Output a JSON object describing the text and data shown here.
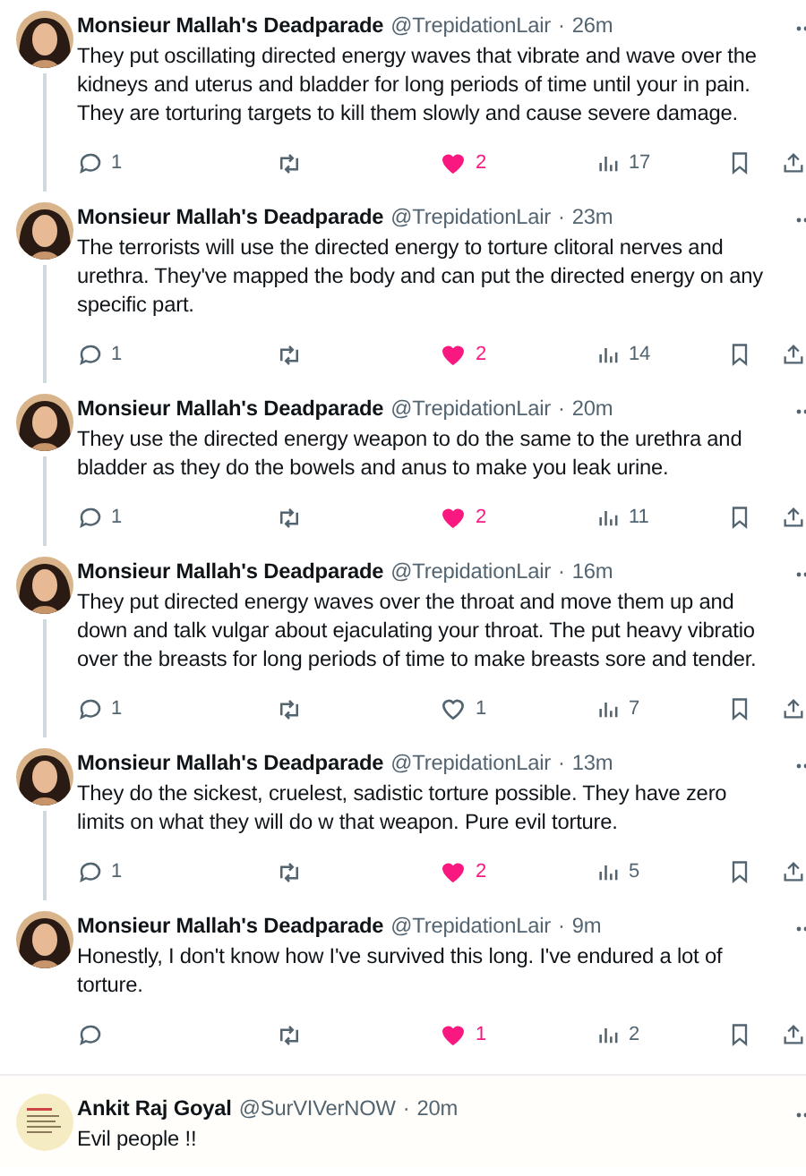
{
  "tweets": [
    {
      "name": "Monsieur Mallah's Deadparade",
      "handle": "@TrepidationLair",
      "sep": "·",
      "time": "26m",
      "lines": [
        "They put oscillating directed energy waves that vibrate and wave over the",
        "kidneys and uterus and bladder for long periods of time until your in pain.",
        "They are torturing targets to kill them slowly and cause severe damage."
      ],
      "replies": "1",
      "liked": true,
      "likes": "2",
      "views": "17",
      "thread_line": true
    },
    {
      "name": "Monsieur Mallah's Deadparade",
      "handle": "@TrepidationLair",
      "sep": "·",
      "time": "23m",
      "lines": [
        "The terrorists will use the directed energy to torture clitoral nerves and",
        "urethra. They've mapped the body and can put the directed energy on any",
        "specific part."
      ],
      "replies": "1",
      "liked": true,
      "likes": "2",
      "views": "14",
      "thread_line": true
    },
    {
      "name": "Monsieur Mallah's Deadparade",
      "handle": "@TrepidationLair",
      "sep": "·",
      "time": "20m",
      "lines": [
        "They use the directed energy weapon to do the same to the urethra and",
        "bladder as they do the bowels and anus to make you leak urine."
      ],
      "replies": "1",
      "liked": true,
      "likes": "2",
      "views": "11",
      "thread_line": true
    },
    {
      "name": "Monsieur Mallah's Deadparade",
      "handle": "@TrepidationLair",
      "sep": "·",
      "time": "16m",
      "lines": [
        "They put directed energy waves over the throat and move them up and",
        "down and talk vulgar about ejaculating your throat. The put heavy vibratio",
        "over the breasts for long periods of time to make breasts sore and tender."
      ],
      "replies": "1",
      "liked": false,
      "likes": "1",
      "views": "7",
      "thread_line": true
    },
    {
      "name": "Monsieur Mallah's Deadparade",
      "handle": "@TrepidationLair",
      "sep": "·",
      "time": "13m",
      "lines": [
        "They do the sickest, cruelest, sadistic torture possible. They have zero",
        "limits on what they will do w that weapon. Pure evil torture."
      ],
      "replies": "1",
      "liked": true,
      "likes": "2",
      "views": "5",
      "thread_line": true
    },
    {
      "name": "Monsieur Mallah's Deadparade",
      "handle": "@TrepidationLair",
      "sep": "·",
      "time": "9m",
      "lines": [
        "Honestly, I don't know how I've survived this long. I've endured a lot of",
        "torture."
      ],
      "liked": true,
      "likes": "1",
      "views": "2",
      "thread_line": false
    }
  ],
  "reply": {
    "name": "Ankit Raj Goyal",
    "handle": "@SurVIVerNOW",
    "sep": "·",
    "time": "20m",
    "lines": [
      "Evil people !!"
    ]
  }
}
